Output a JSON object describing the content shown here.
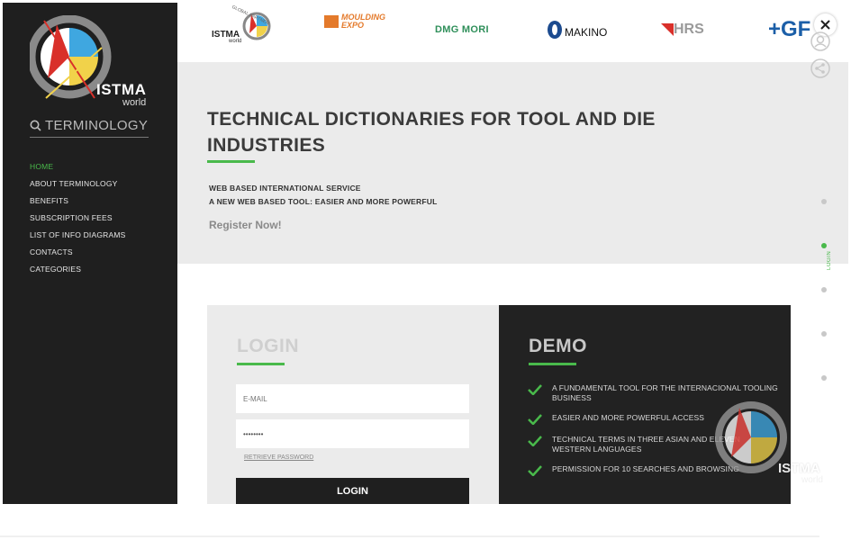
{
  "sidebar": {
    "logo_text": "ISTMA",
    "logo_sub": "world",
    "search_label": "TERMINOLOGY",
    "nav": [
      {
        "label": "HOME",
        "active": true
      },
      {
        "label": "ABOUT TERMINOLOGY",
        "active": false
      },
      {
        "label": "BENEFITS",
        "active": false
      },
      {
        "label": "SUBSCRIPTION FEES",
        "active": false
      },
      {
        "label": "LIST OF INFO DIAGRAMS",
        "active": false
      },
      {
        "label": "CONTACTS",
        "active": false
      },
      {
        "label": "CATEGORIES",
        "active": false
      }
    ]
  },
  "partners": {
    "istma": {
      "name": "ISTMA",
      "sub": "world",
      "badge": "GLOBAL PARTNER"
    },
    "moulding": {
      "line1": "MOULDING",
      "line2": "EXPO"
    },
    "dmg": "DMG MORI",
    "makino": "MAKINO",
    "hrs": "HRS",
    "gf": "+GF"
  },
  "hero": {
    "title": "TECHNICAL DICTIONARIES FOR TOOL AND DIE INDUSTRIES",
    "line1": "WEB BASED INTERNATIONAL SERVICE",
    "line2": "A NEW WEB BASED TOOL: EASIER AND MORE POWERFUL",
    "register": "Register Now!"
  },
  "login": {
    "heading": "LOGIN",
    "email_placeholder": "E-MAIL",
    "password_value": "••••••••",
    "retrieve": "RETRIEVE PASSWORD",
    "button": "LOGIN"
  },
  "demo": {
    "heading": "DEMO",
    "items": [
      "A FUNDAMENTAL TOOL FOR THE INTERNACIONAL TOOLING BUSINESS",
      "EASIER AND MORE POWERFUL ACCESS",
      "TECHNICAL TERMS IN THREE ASIAN AND ELEVEN WESTERN LANGUAGES",
      "PERMISSION FOR 10 SEARCHES AND BROWSING"
    ]
  },
  "side_nav": {
    "active_label": "LOGIN"
  },
  "watermark": {
    "text": "ISTMA",
    "sub": "world"
  },
  "colors": {
    "accent": "#49b94b",
    "sidebar": "#1f1f1f",
    "hero_bg": "#ebebeb",
    "demo_bg": "#222222"
  },
  "icons": {
    "search": "search-icon",
    "check": "check-icon",
    "user": "user-icon",
    "share": "share-icon",
    "close": "close-icon"
  }
}
